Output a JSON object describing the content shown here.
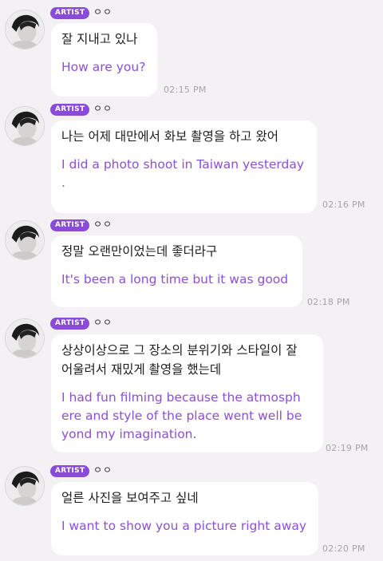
{
  "messages": [
    {
      "badge": "ARTIST",
      "name": "ㅇㅇ",
      "korean": "잘 지내고 있나",
      "english": "How are you?",
      "time": "02:15 PM"
    },
    {
      "badge": "ARTIST",
      "name": "ㅇㅇ",
      "korean": "나는 어제 대만에서 화보 촬영을 하고 왔어",
      "english": "I did a photo shoot in Taiwan yesterday\n.",
      "time": "02:16 PM"
    },
    {
      "badge": "ARTIST",
      "name": "ㅇㅇ",
      "korean": "정말 오랜만이었는데 좋더라구",
      "english": "It's been a long time but it was good",
      "time": "02:18 PM"
    },
    {
      "badge": "ARTIST",
      "name": "ㅇㅇ",
      "korean": "상상이상으로 그 장소의 분위기와 스타일이 잘\n어울려서 재밌게 촬영을 했는데",
      "english": "I had fun filming because the atmosph\nere and style of the place went well be\nyond my imagination.",
      "time": "02:19 PM"
    },
    {
      "badge": "ARTIST",
      "name": "ㅇㅇ",
      "korean": "얼른 사진을 보여주고 싶네",
      "english": "I want to show you a picture right away",
      "time": "02:20 PM"
    }
  ]
}
